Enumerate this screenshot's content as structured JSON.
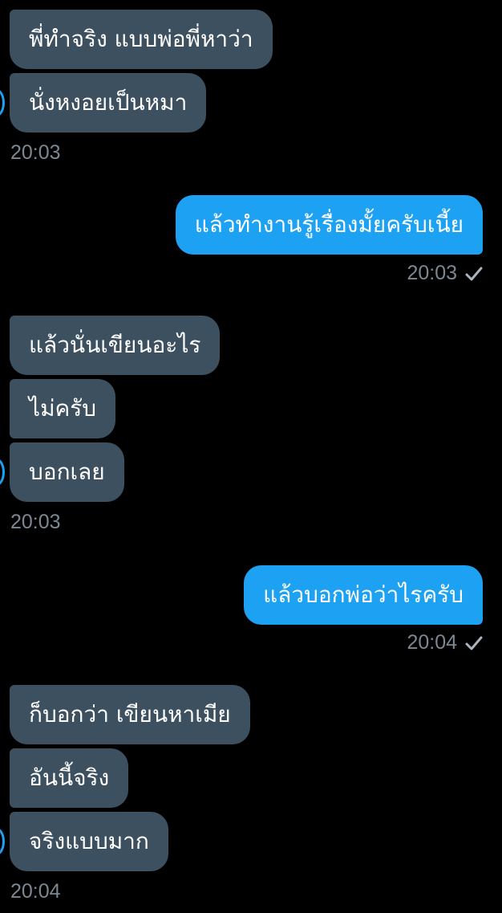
{
  "messages": {
    "g1": {
      "m1": "พี่ทำจริง แบบพ่อพี่หาว่า",
      "m2": "นั่งหงอยเป็นหมา",
      "time": "20:03"
    },
    "o1": {
      "text": "แล้วทำงานรู้เรื่องมั้ยครับเนี้ย",
      "time": "20:03"
    },
    "g2": {
      "m1": "แล้วนั่นเขียนอะไร",
      "m2": "ไม่ครับ",
      "m3": "บอกเลย",
      "time": "20:03"
    },
    "o2": {
      "text": "แล้วบอกพ่อว่าไรครับ",
      "time": "20:04"
    },
    "g3": {
      "m1": "ก็บอกว่า เขียนหาเมีย",
      "m2": "อันนี้จริง",
      "m3": "จริงแบบมาก",
      "time": "20:04"
    }
  },
  "colors": {
    "background": "#000000",
    "incoming_bubble": "#3d5060",
    "outgoing_bubble": "#1da1f2",
    "timestamp": "#7b8893"
  },
  "icons": {
    "read_receipt": "checkmark-icon",
    "avatar": "avatar-edge"
  }
}
